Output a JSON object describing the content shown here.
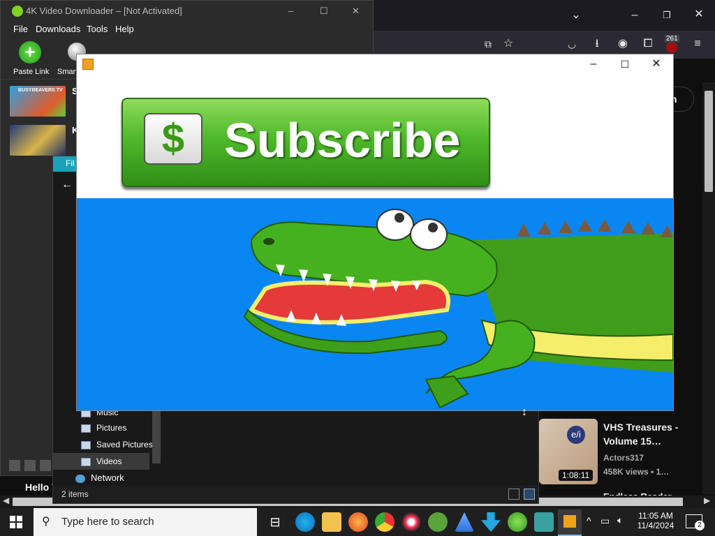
{
  "browser": {
    "badge_count": "261",
    "signin_label": "in",
    "video_card": {
      "title": "VHS Treasures - Volume 15…",
      "channel": "Actors317",
      "meta": "458K views • 1…",
      "duration": "1:08:11",
      "thumb_badge": "e/i"
    },
    "next_card_title": "Endless Reader",
    "left_partial_text": "Hello V"
  },
  "fourk": {
    "title": "4K Video Downloader – [Not Activated]",
    "menu": [
      "File",
      "Downloads",
      "Tools",
      "Help"
    ],
    "toolbar": {
      "paste_link": "Paste Link",
      "smart_mode": "Smart"
    },
    "downloads": [
      {
        "name": "S",
        "thumb_label": "BUSYBEAVERS TV"
      },
      {
        "name": "K",
        "thumb_label": ""
      }
    ]
  },
  "explorer": {
    "tab_label": "Fil",
    "nav_items": [
      "Music",
      "Pictures",
      "Saved Pictures",
      "Videos",
      "Network"
    ],
    "selected_item": "Videos",
    "status": "2 items"
  },
  "player": {
    "subscribe_text": "Subscribe",
    "dollar_glyph": "$"
  },
  "taskbar": {
    "search_placeholder": "Type here to search",
    "time": "11:05 AM",
    "date": "11/4/2024",
    "notification_count": "2"
  },
  "colors": {
    "video_background": "#0a86f2",
    "subscribe_green": "#4fb92a",
    "taskbar": "#1f1f1f"
  }
}
